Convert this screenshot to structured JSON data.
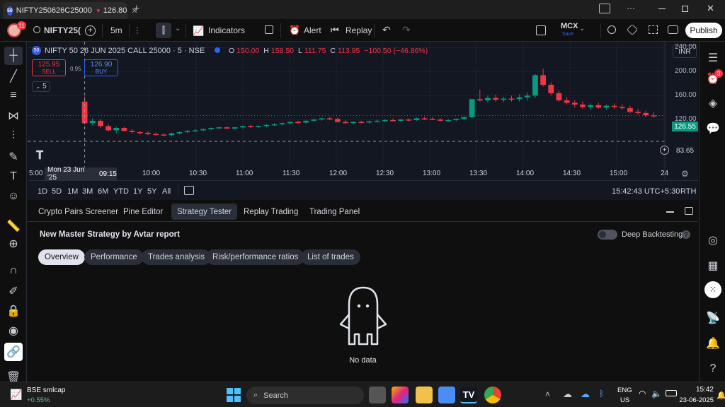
{
  "browser": {
    "tab_title": "NIFTY250626C25000",
    "tab_price": "126.80",
    "tab_arrow": "▼",
    "tab_badge": "50",
    "new_tab": "+"
  },
  "toolbar": {
    "notif_count": "11",
    "symbol": "NIFTY25(",
    "interval": "5m",
    "indicators": "Indicators",
    "alert": "Alert",
    "replay": "Replay",
    "exchange": "MCX",
    "exchange_sub": "Save",
    "publish": "Publish"
  },
  "legend": {
    "name": "NIFTY 50 26 JUN 2025 CALL 25000 · 5 · NSE",
    "o_label": "O",
    "o": "150.00",
    "h_label": "H",
    "h": "158.50",
    "l_label": "L",
    "l": "111.75",
    "c_label": "C",
    "c": "113.95",
    "change": "−100.50 (−46.86%)",
    "sell_price": "125.95",
    "sell": "SELL",
    "spread": "0.95",
    "buy_price": "126.90",
    "buy": "BUY",
    "collapse": "5",
    "currency": "INR"
  },
  "price_axis": {
    "ticks": [
      "240.00",
      "200.00",
      "160.00",
      "120.00"
    ],
    "last_price": "126.55",
    "crosshair_price": "83.65"
  },
  "time_axis": {
    "ticks": [
      "5:00",
      "10:00",
      "10:30",
      "11:00",
      "11:30",
      "12:00",
      "12:30",
      "13:00",
      "13:30",
      "14:00",
      "14:30",
      "15:00",
      "24"
    ],
    "crosshair_label": "Mon 23 Jun '25",
    "crosshair_time": "09:15"
  },
  "ranges": [
    "1D",
    "5D",
    "1M",
    "3M",
    "6M",
    "YTD",
    "1Y",
    "5Y",
    "All"
  ],
  "clock": {
    "time": "15:42:43 UTC+5:30",
    "session": "RTH"
  },
  "panel": {
    "tabs": [
      "Crypto Pairs Screener",
      "Pine Editor",
      "Strategy Tester",
      "Replay Trading",
      "Trading Panel"
    ],
    "active_tab": "Strategy Tester",
    "strategy": "New Master Strategy by Avtar report",
    "deep_backtesting": "Deep Backtesting",
    "subtabs": [
      "Overview",
      "Performance",
      "Trades analysis",
      "Risk/performance ratios",
      "List of trades"
    ],
    "active_subtab": "Overview",
    "empty": "No data"
  },
  "rightbar": {
    "alerts_count": "3"
  },
  "taskbar": {
    "ticker": "BSE smlcap",
    "ticker_change": "+0.55%",
    "search": "Search",
    "lang1": "ENG",
    "lang2": "US",
    "time": "15:42",
    "date": "23-06-2025"
  },
  "chart_data": {
    "type": "candlestick",
    "price_range": [
      40,
      250
    ],
    "candles": [
      [
        150,
        158.5,
        112,
        114
      ],
      [
        114,
        122,
        110,
        118
      ],
      [
        118,
        121,
        106,
        109
      ],
      [
        109,
        112,
        100,
        102
      ],
      [
        102,
        108,
        97,
        106
      ],
      [
        106,
        108,
        100,
        101
      ],
      [
        101,
        104,
        97,
        99
      ],
      [
        99,
        101,
        95,
        98
      ],
      [
        98,
        100,
        94,
        96
      ],
      [
        96,
        98,
        93,
        95
      ],
      [
        95,
        97,
        92,
        94
      ],
      [
        94,
        98,
        92,
        97
      ],
      [
        97,
        100,
        95,
        99
      ],
      [
        99,
        103,
        97,
        101
      ],
      [
        101,
        104,
        99,
        102
      ],
      [
        102,
        105,
        100,
        104
      ],
      [
        104,
        107,
        102,
        106
      ],
      [
        106,
        108,
        104,
        107
      ],
      [
        107,
        109,
        104,
        105
      ],
      [
        105,
        108,
        103,
        107
      ],
      [
        107,
        110,
        105,
        109
      ],
      [
        109,
        111,
        106,
        108
      ],
      [
        108,
        110,
        106,
        109
      ],
      [
        109,
        112,
        107,
        111
      ],
      [
        111,
        114,
        109,
        112
      ],
      [
        112,
        115,
        110,
        114
      ],
      [
        114,
        117,
        112,
        116
      ],
      [
        116,
        118,
        113,
        115
      ],
      [
        115,
        119,
        113,
        118
      ],
      [
        118,
        121,
        116,
        120
      ],
      [
        120,
        123,
        118,
        122
      ],
      [
        122,
        124,
        119,
        121
      ],
      [
        121,
        123,
        115,
        116
      ],
      [
        116,
        119,
        113,
        114
      ],
      [
        114,
        117,
        112,
        116
      ],
      [
        116,
        118,
        114,
        115
      ],
      [
        115,
        118,
        113,
        117
      ],
      [
        117,
        120,
        115,
        118
      ],
      [
        118,
        121,
        116,
        119
      ],
      [
        119,
        122,
        117,
        118
      ],
      [
        118,
        121,
        116,
        120
      ],
      [
        120,
        122,
        117,
        119
      ],
      [
        119,
        123,
        118,
        122
      ],
      [
        122,
        124,
        119,
        121
      ],
      [
        121,
        124,
        119,
        120
      ],
      [
        120,
        122,
        117,
        118
      ],
      [
        118,
        121,
        116,
        119
      ],
      [
        119,
        122,
        117,
        121
      ],
      [
        121,
        125,
        119,
        124
      ],
      [
        124,
        155,
        122,
        154
      ],
      [
        154,
        170,
        150,
        152
      ],
      [
        152,
        160,
        148,
        156
      ],
      [
        156,
        162,
        150,
        153
      ],
      [
        153,
        158,
        149,
        155
      ],
      [
        155,
        160,
        150,
        154
      ],
      [
        154,
        162,
        150,
        157
      ],
      [
        157,
        165,
        152,
        160
      ],
      [
        160,
        196,
        156,
        194
      ],
      [
        194,
        205,
        175,
        178
      ],
      [
        178,
        182,
        160,
        164
      ],
      [
        164,
        168,
        150,
        152
      ],
      [
        152,
        158,
        145,
        148
      ],
      [
        148,
        152,
        140,
        145
      ],
      [
        145,
        150,
        138,
        141
      ],
      [
        141,
        147,
        136,
        144
      ],
      [
        144,
        148,
        138,
        140
      ],
      [
        140,
        145,
        136,
        143
      ],
      [
        143,
        147,
        138,
        141
      ],
      [
        141,
        146,
        136,
        139
      ],
      [
        139,
        143,
        130,
        133
      ],
      [
        133,
        138,
        128,
        131
      ],
      [
        131,
        135,
        124,
        127
      ],
      [
        127,
        132,
        123,
        126.55
      ]
    ]
  },
  "colors": {
    "up": "#089981",
    "down": "#f23645",
    "chart_bg": "#131722",
    "grid": "#1e222d",
    "accent": "#2962ff"
  }
}
